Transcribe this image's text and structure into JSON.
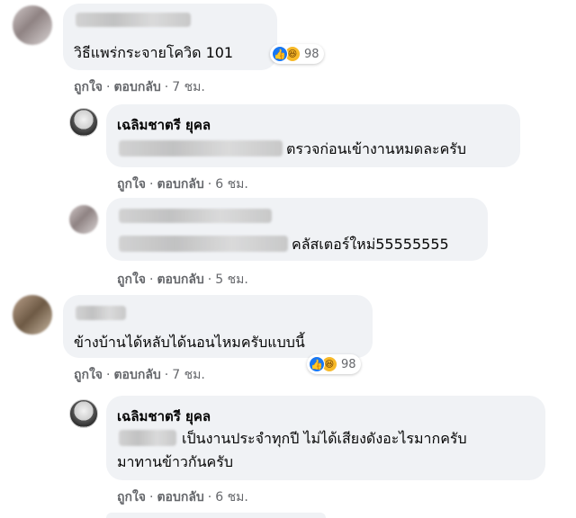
{
  "labels": {
    "like": "ถูกใจ",
    "reply": "ตอบกลับ",
    "separator": "·"
  },
  "comments": [
    {
      "text": "วิธีแพร่กระจายโควิด 101",
      "time": "7 ชม.",
      "reactions": {
        "count": "98",
        "icons": [
          "like-icon",
          "haha-icon"
        ]
      },
      "reply": {
        "name": "เฉลิมชาตรี ยุคล",
        "text": "ตรวจก่อนเข้างานหมดละครับ",
        "time": "6 ชม."
      },
      "reply2": {
        "text": "คลัสเตอร์ใหม่55555555",
        "time": "5 ชม."
      }
    },
    {
      "text": "ข้างบ้านได้หลับได้นอนไหมครับแบบนี้",
      "time": "7 ชม.",
      "reactions": {
        "count": "98",
        "icons": [
          "like-icon",
          "haha-icon"
        ]
      },
      "reply": {
        "name": "เฉลิมชาตรี ยุคล",
        "text_line1": "เป็นงานประจำทุกปี ไม่ได้เสียงดังอะไรมากครับ",
        "text_line2": "มาทานข้าวกันครับ",
        "time": "6 ชม."
      }
    }
  ],
  "colors": {
    "bubble": "#f0f2f5",
    "meta": "#65676b",
    "like": "#1877f2",
    "haha": "#f7b928"
  }
}
